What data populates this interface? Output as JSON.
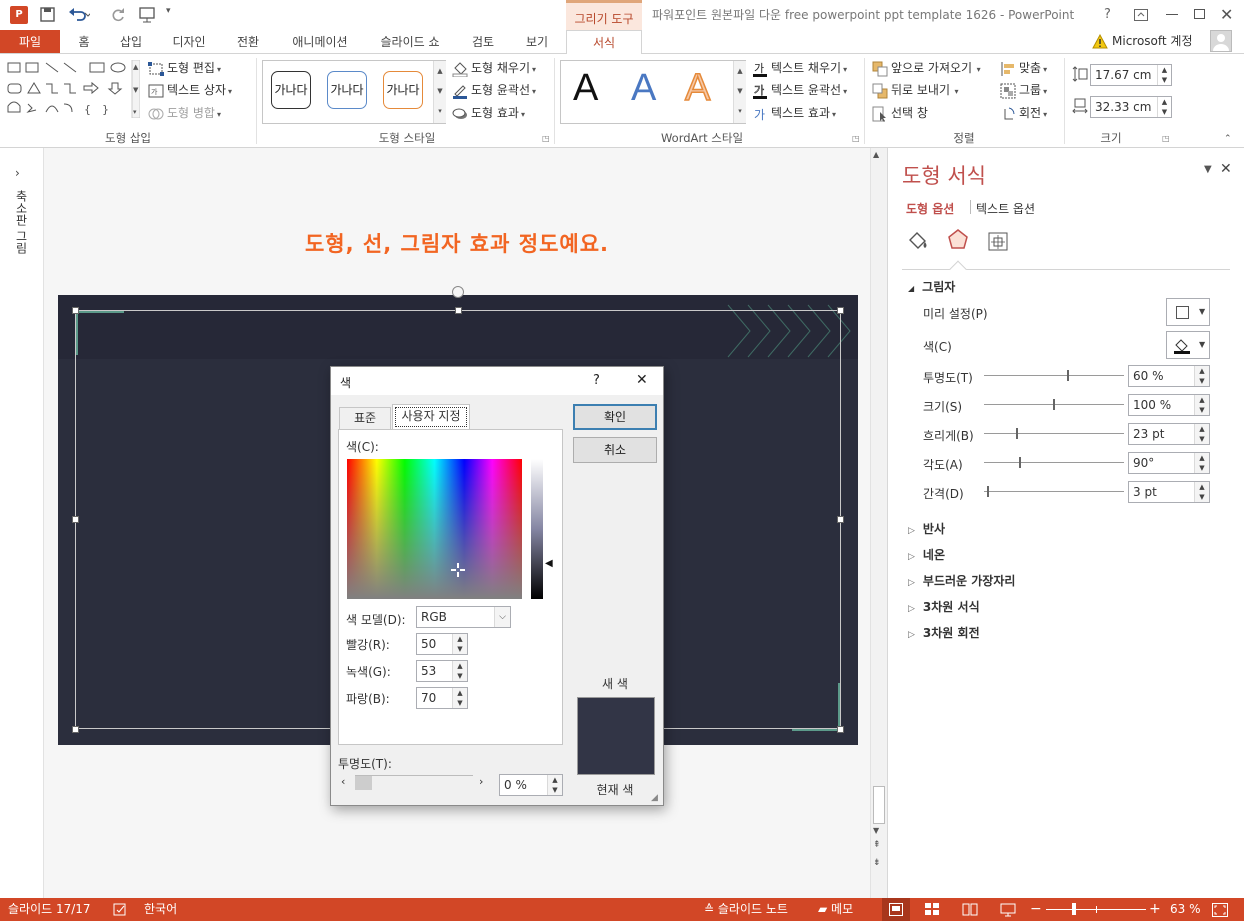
{
  "app": {
    "context_tab": "그리기 도구",
    "title": "파워포인트 원본파일 다운 free powerpoint ppt template 1626 - PowerPoint",
    "help": "?",
    "account": "Microsoft 계정"
  },
  "tabs": [
    "파일",
    "홈",
    "삽입",
    "디자인",
    "전환",
    "애니메이션",
    "슬라이드 쇼",
    "검토",
    "보기",
    "서식"
  ],
  "ribbon": {
    "insert_shapes": {
      "label": "도형 삽입",
      "edit_shape": "도형 편집",
      "text_box": "텍스트 상자",
      "merge_shapes": "도형 병합"
    },
    "shape_styles": {
      "label": "도형 스타일",
      "preset": "가나다",
      "fill": "도형 채우기",
      "outline": "도형 윤곽선",
      "effects": "도형 효과"
    },
    "wordart": {
      "label": "WordArt 스타일",
      "letter": "A",
      "text_fill": "텍스트 채우기",
      "text_outline": "텍스트 윤곽선",
      "text_effects": "텍스트 효과"
    },
    "arrange": {
      "label": "정렬",
      "bring_forward": "앞으로 가져오기",
      "send_backward": "뒤로 보내기",
      "selection_pane": "선택 창",
      "align": "맞춤",
      "group": "그룹",
      "rotate": "회전"
    },
    "size": {
      "label": "크기",
      "height": "17.67 cm",
      "width": "32.33 cm"
    }
  },
  "thumbnail_label": "축소판 그림",
  "slide": {
    "heading": "도형, 선, 그림자 효과 정도예요."
  },
  "color_dialog": {
    "title": "색",
    "help": "?",
    "tab_standard": "표준",
    "tab_custom": "사용자 지정",
    "colors_label": "색(C):",
    "model_label": "색 모델(D):",
    "model_value": "RGB",
    "red_label": "빨강(R):",
    "red_value": "50",
    "green_label": "녹색(G):",
    "green_value": "53",
    "blue_label": "파랑(B):",
    "blue_value": "70",
    "transparency_label": "투명도(T):",
    "transparency_value": "0 %",
    "ok": "확인",
    "cancel": "취소",
    "new_label": "새 색",
    "current_label": "현재 색",
    "new_color": "#323546",
    "current_color": "#323546"
  },
  "format_pane": {
    "title": "도형 서식",
    "tab_shape": "도형 옵션",
    "tab_text": "텍스트 옵션",
    "shadow": {
      "label": "그림자",
      "presets_label": "미리 설정(P)",
      "color_label": "색(C)",
      "rows": [
        {
          "label": "투명도(T)",
          "value": "60 %",
          "level": 0.6
        },
        {
          "label": "크기(S)",
          "value": "100 %",
          "level": 0.5
        },
        {
          "label": "흐리게(B)",
          "value": "23 pt",
          "level": 0.23
        },
        {
          "label": "각도(A)",
          "value": "90°",
          "level": 0.25
        },
        {
          "label": "간격(D)",
          "value": "3 pt",
          "level": 0.02
        }
      ]
    },
    "sections": [
      "반사",
      "네온",
      "부드러운 가장자리",
      "3차원 서식",
      "3차원 회전"
    ]
  },
  "status": {
    "slide": "슬라이드 17/17",
    "language": "한국어",
    "notes": "슬라이드 노트",
    "comments": "메모",
    "zoom": "63 %"
  },
  "colors": {
    "accent": "#d24726",
    "slide_bg": "#2b2e3d",
    "heading": "#f26522"
  }
}
